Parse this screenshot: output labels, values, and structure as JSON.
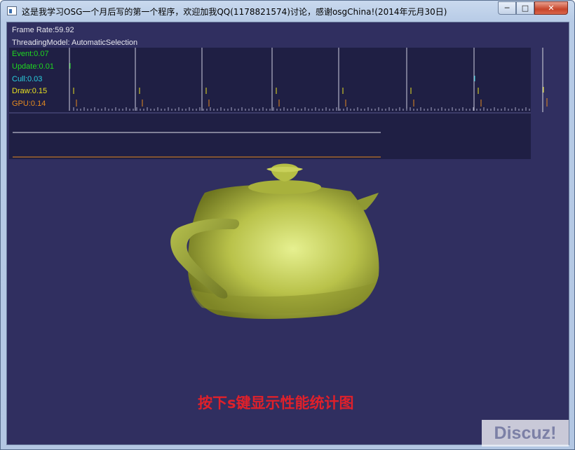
{
  "window": {
    "title": "这是我学习OSG一个月后写的第一个程序，欢迎加我QQ(1178821574)讨论，感谢osgChina!(2014年元月30日)",
    "controls": {
      "minimize": "─",
      "maximize": "□",
      "close": "✕"
    }
  },
  "hud": {
    "frame_rate": "Frame Rate:59.92",
    "threading_model": "ThreadingModel: AutomaticSelection"
  },
  "stats": [
    {
      "label": "Event:0.07",
      "color": "#1fd81f"
    },
    {
      "label": "Update:0.01",
      "color": "#1fd81f"
    },
    {
      "label": "Cull:0.03",
      "color": "#2ad0e0"
    },
    {
      "label": "Draw:0.15",
      "color": "#e8e020"
    },
    {
      "label": "GPU:0.14",
      "color": "#e48a20"
    }
  ],
  "caption": "按下s键显示性能统计图",
  "watermark": "Discuz!",
  "icons": {
    "app": "window-icon",
    "teapot": "utah-teapot-3d"
  }
}
